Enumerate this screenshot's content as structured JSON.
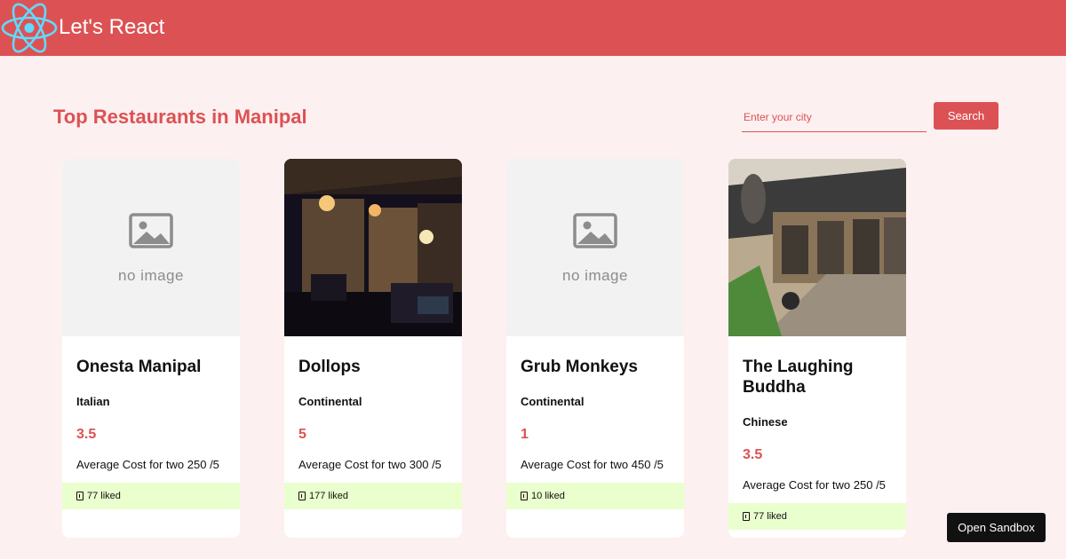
{
  "header": {
    "logo_icon": "react-atom-icon",
    "title": "Let's React",
    "color": "#dc5254"
  },
  "main": {
    "title": "Top Restaurants in Manipal",
    "search": {
      "placeholder": "Enter your city",
      "value": "",
      "button_label": "Search"
    }
  },
  "restaurants": [
    {
      "image": "no-image-placeholder",
      "placeholder_text": "no image",
      "name": "Onesta Manipal",
      "cuisine": "Italian",
      "rating": "3.5",
      "cost": "Average Cost for two 250 /5",
      "likes": "77 liked"
    },
    {
      "image": "restaurant-interior-photo",
      "name": "Dollops",
      "cuisine": "Continental",
      "rating": "5",
      "cost": "Average Cost for two 300 /5",
      "likes": "177 liked"
    },
    {
      "image": "no-image-placeholder",
      "placeholder_text": "no image",
      "name": "Grub Monkeys",
      "cuisine": "Continental",
      "rating": "1",
      "cost": "Average Cost for two 450 /5",
      "likes": "10 liked"
    },
    {
      "image": "restaurant-storefront-photo",
      "name": "The Laughing Buddha",
      "cuisine": "Chinese",
      "rating": "3.5",
      "cost": "Average Cost for two 250 /5",
      "likes": "77 liked"
    }
  ],
  "sandbox_button": "Open Sandbox",
  "colors": {
    "accent": "#dc5254",
    "page_background": "#fdf0f0",
    "likes_background": "#eaffce"
  }
}
